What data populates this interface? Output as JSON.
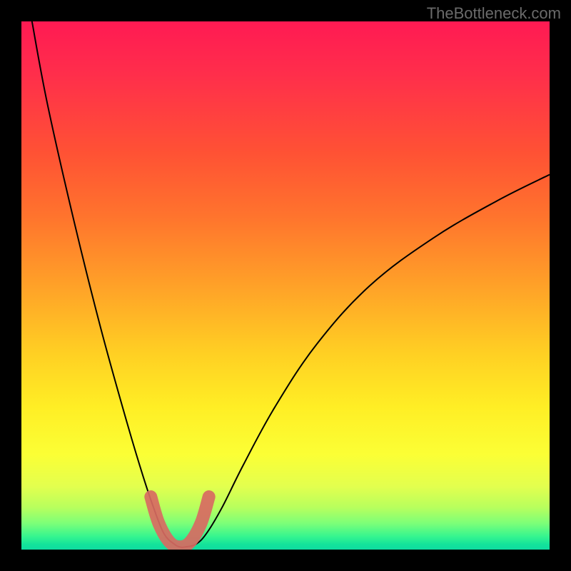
{
  "watermark": "TheBottleneck.com",
  "chart_data": {
    "type": "line",
    "title": "",
    "xlabel": "",
    "ylabel": "",
    "xlim": [
      0,
      100
    ],
    "ylim": [
      0,
      100
    ],
    "grid": false,
    "series": [
      {
        "name": "bottleneck-curve",
        "x": [
          2,
          5,
          10,
          15,
          20,
          23,
          25,
          27,
          29,
          30,
          31,
          33,
          35,
          38,
          42,
          48,
          56,
          66,
          78,
          90,
          100
        ],
        "y": [
          100,
          84,
          62,
          42,
          24,
          14,
          8,
          3,
          1,
          0.5,
          0.5,
          1,
          3,
          8,
          16,
          27,
          39,
          50,
          59,
          66,
          71
        ]
      }
    ],
    "highlight": {
      "name": "optimal-range",
      "x": [
        24.5,
        26,
        28,
        30,
        32,
        34,
        35.5
      ],
      "y": [
        10,
        5,
        1.5,
        0.5,
        1.5,
        5,
        10
      ]
    },
    "background_gradient": {
      "top": "#ff1a53",
      "mid": "#ffee25",
      "bottom": "#0fdca0"
    }
  }
}
